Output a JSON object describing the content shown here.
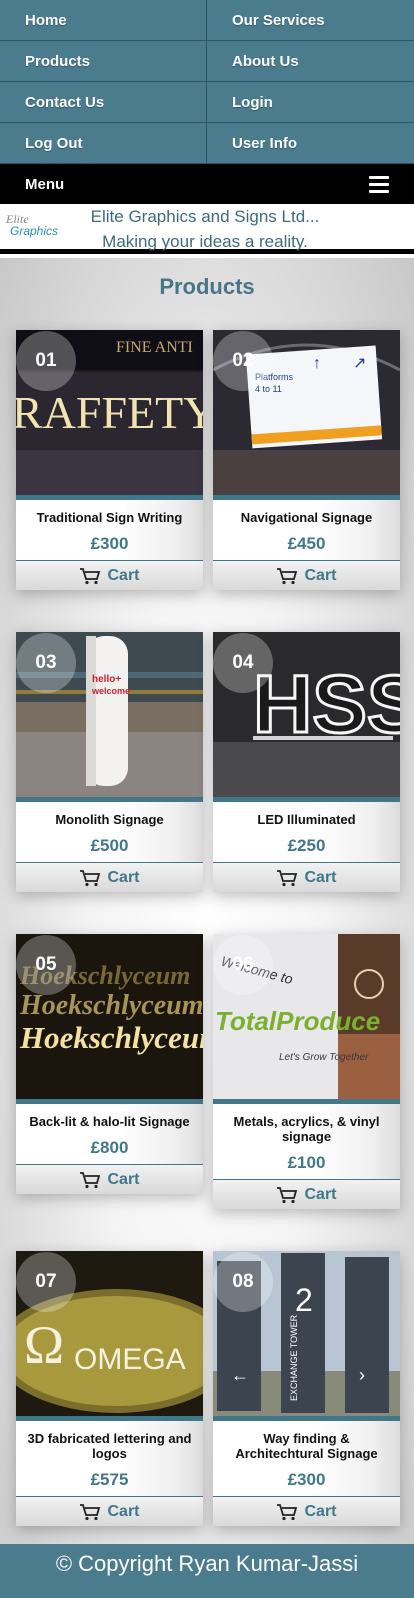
{
  "nav": {
    "items": [
      {
        "label": "Home"
      },
      {
        "label": "Our Services"
      },
      {
        "label": "Products"
      },
      {
        "label": "About Us"
      },
      {
        "label": "Contact Us"
      },
      {
        "label": "Login"
      },
      {
        "label": "Log Out"
      },
      {
        "label": "User Info"
      }
    ],
    "menu_label": "Menu",
    "menu_icon": "hamburger-icon"
  },
  "brand": {
    "logo_line1": "Elite",
    "logo_line2": "Graphics",
    "title": "Elite Graphics and Signs Ltd...",
    "tagline": "Making your ideas a reality."
  },
  "products": {
    "heading": "Products",
    "cart_label": "Cart",
    "cart_icon": "cart-icon",
    "items": [
      {
        "num": "01",
        "name": "Traditional Sign Writing",
        "price": "£300",
        "image_text": "RAFFETY",
        "image_subtext": "FINE ANTI"
      },
      {
        "num": "02",
        "name": "Navigational Signage",
        "price": "£450",
        "image_text": "Platforms",
        "image_subtext": "4 to 11"
      },
      {
        "num": "03",
        "name": "Monolith Signage",
        "price": "£500",
        "image_text": "hello+",
        "image_subtext": "welcome"
      },
      {
        "num": "04",
        "name": "LED Illuminated",
        "price": "£250",
        "image_text": "HSS",
        "image_subtext": ""
      },
      {
        "num": "05",
        "name": "Back-lit & halo-lit Signage",
        "price": "£800",
        "image_text": "Hoekschlyceum",
        "image_subtext": ""
      },
      {
        "num": "06",
        "name": "Metals, acrylics, & vinyl signage",
        "price": "£100",
        "image_text": "TotalProduce",
        "image_subtext": "Let's Grow Together"
      },
      {
        "num": "07",
        "name": "3D fabricated lettering and logos",
        "price": "£575",
        "image_text": "OMEGA",
        "image_subtext": "Ω"
      },
      {
        "num": "08",
        "name": "Way finding & Architechtural Signage",
        "price": "£300",
        "image_text": "EXCHANGE TOWER",
        "image_subtext": "2"
      }
    ]
  },
  "footer": {
    "copyright": "© Copyright Ryan Kumar-Jassi"
  },
  "colors": {
    "teal": "#4a7c8e",
    "accent": "#40788a",
    "header_text": "#3e6b7c"
  }
}
